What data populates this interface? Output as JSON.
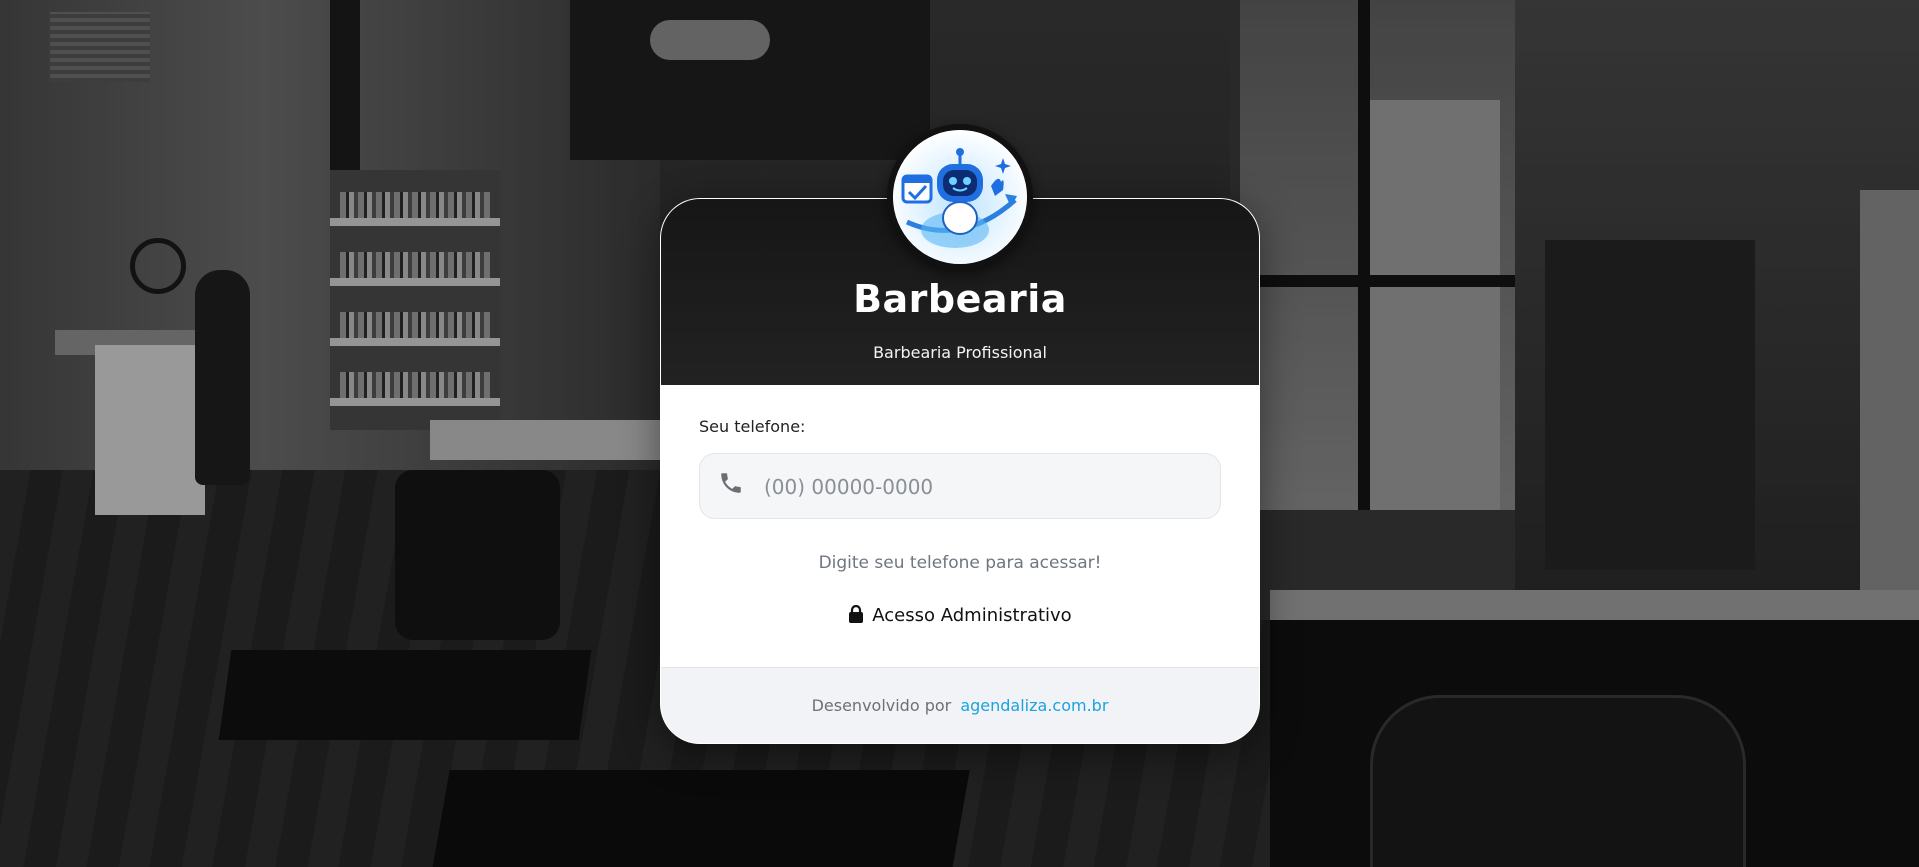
{
  "brand": {
    "name": "Barbearia",
    "tagline": "Barbearia Profissional"
  },
  "login": {
    "phone_label": "Seu telefone:",
    "phone_placeholder": "(00) 00000-0000",
    "phone_value": "",
    "hint": "Digite seu telefone para acessar!",
    "admin_label": "Acesso Administrativo"
  },
  "footer": {
    "prefix": "Desenvolvido por",
    "link_text": "agendaliza.com.br"
  },
  "icons": {
    "logo": "robot-mascot-icon",
    "phone": "phone-icon",
    "lock": "lock-icon"
  },
  "colors": {
    "header_bg": "#1b1b1b",
    "link": "#1aa3e0",
    "field_bg": "#f5f6f8",
    "footer_bg": "#f1f3f6"
  }
}
